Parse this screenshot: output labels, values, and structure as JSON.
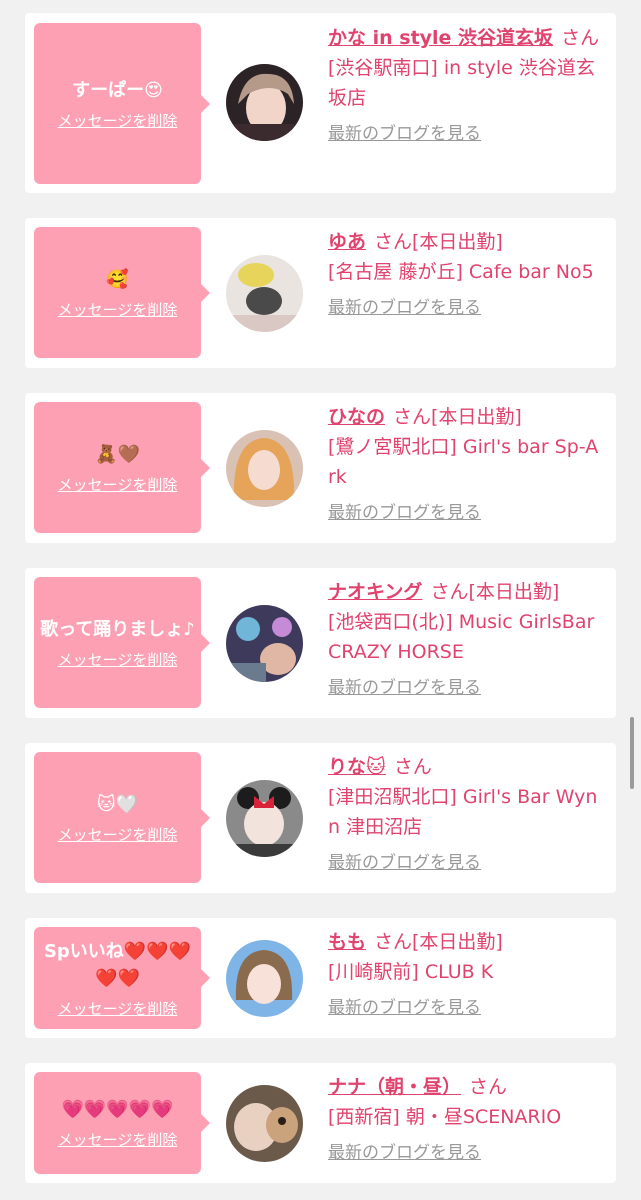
{
  "delete_label": "メッセージを削除",
  "blog_label": "最新のブログを見る",
  "san_label": "さん",
  "working_label": "[本日出勤]",
  "colors": {
    "accent": "#e0436e",
    "bubble": "#fea0b3",
    "link_gray": "#999999",
    "background": "#f1f1f1"
  },
  "items": [
    {
      "message": "すーぱー😍",
      "name": "かな in style 渋谷道玄坂",
      "suffix": "さん",
      "shop": "[渋谷駅南口] in style 渋谷道玄坂店",
      "blog": "最新のブログを見る"
    },
    {
      "message": "🥰",
      "name": "ゆあ",
      "suffix": "さん[本日出勤]",
      "shop": "[名古屋 藤が丘] Cafe bar No5",
      "blog": "最新のブログを見る"
    },
    {
      "message": "🧸🤎",
      "name": "ひなの",
      "suffix": "さん[本日出勤]",
      "shop": "[鷺ノ宮駅北口] Girl's bar Sp-Ark",
      "blog": "最新のブログを見る"
    },
    {
      "message": "歌って踊りましょ♪",
      "name": "ナオキング",
      "suffix": "さん[本日出勤]",
      "shop": "[池袋西口(北)] Music GirlsBar CRAZY HORSE",
      "blog": "最新のブログを見る"
    },
    {
      "message": "🐱🤍",
      "name": "りな🐱",
      "suffix": "さん",
      "shop": "[津田沼駅北口] Girl's Bar Wynn 津田沼店",
      "blog": "最新のブログを見る"
    },
    {
      "message": "Spいいね❤️❤️❤️❤️❤️",
      "name": "もも",
      "suffix": "さん[本日出勤]",
      "shop": "[川崎駅前] CLUB K",
      "blog": "最新のブログを見る"
    },
    {
      "message": "💗💗💗💗💗",
      "name": "ナナ（朝・昼）",
      "suffix": "さん",
      "shop": "[西新宿] 朝・昼SCENARIO",
      "blog": "最新のブログを見る"
    }
  ]
}
